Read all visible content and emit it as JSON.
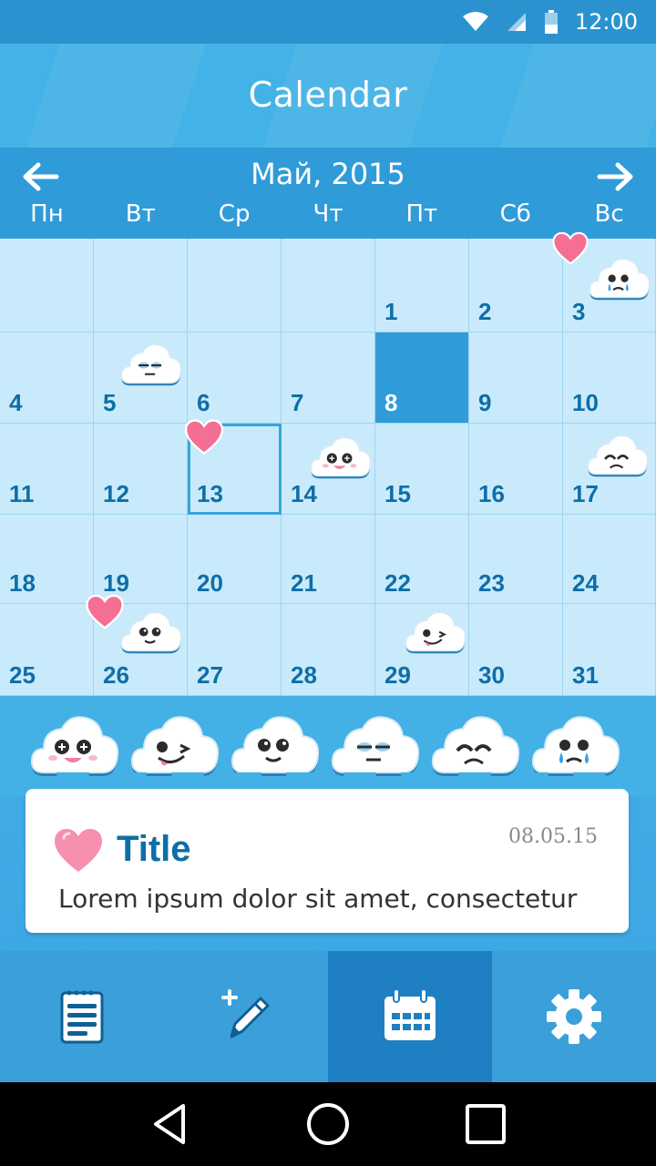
{
  "status": {
    "time": "12:00",
    "icons": [
      "wifi-icon",
      "signal-icon",
      "battery-icon"
    ]
  },
  "header": {
    "title": "Calendar"
  },
  "month_nav": {
    "title": "Май, 2015",
    "prev_icon": "arrow-left-icon",
    "next_icon": "arrow-right-icon"
  },
  "weekdays": [
    "Пн",
    "Вт",
    "Ср",
    "Чт",
    "Пт",
    "Сб",
    "Вс"
  ],
  "days": [
    "1",
    "2",
    "3",
    "4",
    "5",
    "6",
    "7",
    "8",
    "9",
    "10",
    "11",
    "12",
    "13",
    "14",
    "15",
    "16",
    "17",
    "18",
    "19",
    "20",
    "21",
    "22",
    "23",
    "24",
    "25",
    "26",
    "27",
    "28",
    "29",
    "30",
    "31"
  ],
  "selected_day": "8",
  "today_day": "13",
  "moods": [
    "laughing-cloud-icon",
    "winking-cloud-icon",
    "smiling-cloud-icon",
    "neutral-cloud-icon",
    "sad-cloud-icon",
    "crying-cloud-icon"
  ],
  "note": {
    "title": "Title",
    "date": "08.05.15",
    "body": "Lorem ipsum dolor sit amet, consectetur"
  },
  "tabs": [
    "notes-icon",
    "add-note-icon",
    "calendar-icon",
    "settings-icon"
  ],
  "colors": {
    "primary": "#43b2e6",
    "accent_dark": "#2f9cd9",
    "grid_bg": "#c9eafb",
    "day_text": "#0e6ea8",
    "heart": "#f46f93"
  }
}
